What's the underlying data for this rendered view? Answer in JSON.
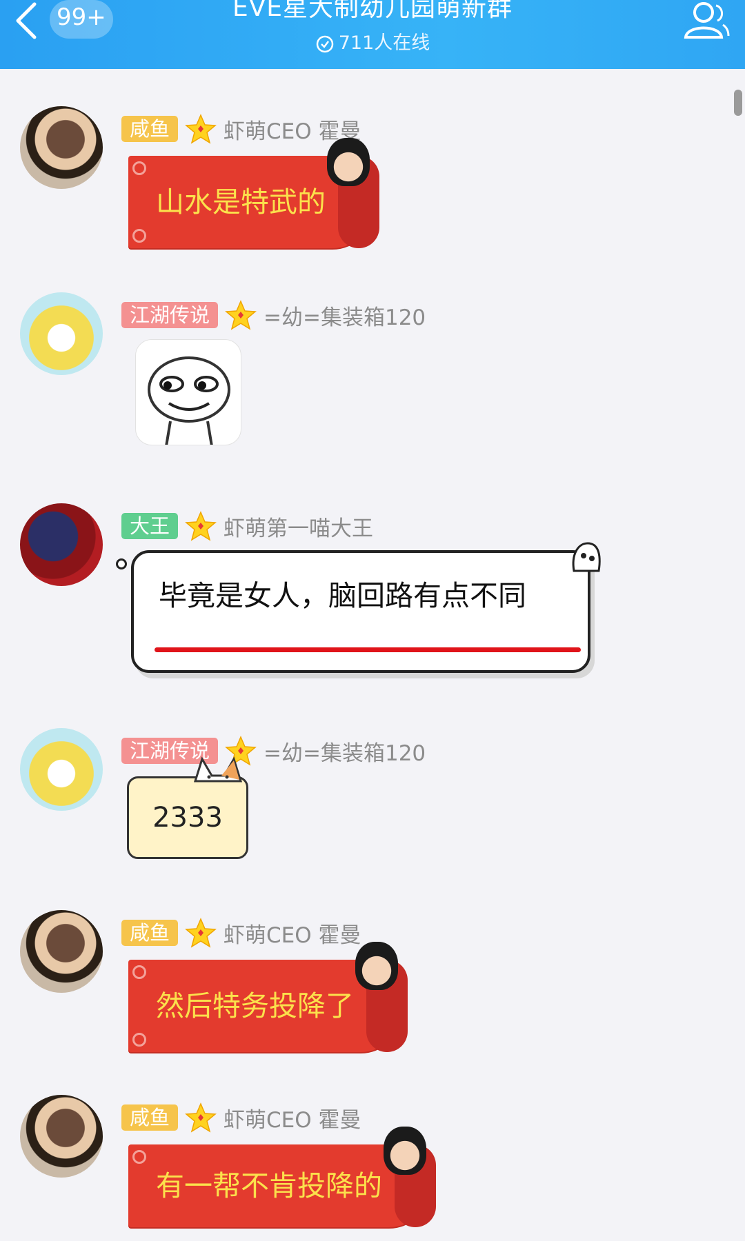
{
  "header": {
    "back_icon": "chevron-left-icon",
    "unread_count": "99+",
    "title": "EVE星大制幼儿园萌新群",
    "online_text": "711人在线",
    "online_icon": "check-circle-icon",
    "members_icon": "group-members-icon"
  },
  "messages": [
    {
      "sender_role": "咸鱼",
      "role_color": "#f6c44b",
      "nickname": "虾萌CEO 霍曼",
      "type": "red-scroll",
      "text": "山水是特武的"
    },
    {
      "sender_role": "江湖传说",
      "role_color": "#f49191",
      "nickname": "=幼=集装箱120",
      "type": "emoji-image",
      "text": ""
    },
    {
      "sender_role": "大王",
      "role_color": "#5fce8f",
      "nickname": "虾萌第一喵大王",
      "type": "cloud",
      "text": "毕竟是女人，脑回路有点不同"
    },
    {
      "sender_role": "江湖传说",
      "role_color": "#f49191",
      "nickname": "=幼=集装箱120",
      "type": "cat",
      "text": "2333"
    },
    {
      "sender_role": "咸鱼",
      "role_color": "#f6c44b",
      "nickname": "虾萌CEO 霍曼",
      "type": "red-scroll",
      "text": "然后特务投降了"
    },
    {
      "sender_role": "咸鱼",
      "role_color": "#f6c44b",
      "nickname": "虾萌CEO 霍曼",
      "type": "red-scroll",
      "text": "有一帮不肯投降的"
    }
  ],
  "colors": {
    "header_blue": "#2aa0f2",
    "red_bubble": "#e33b2e",
    "red_bubble_text": "#fbe14c"
  }
}
